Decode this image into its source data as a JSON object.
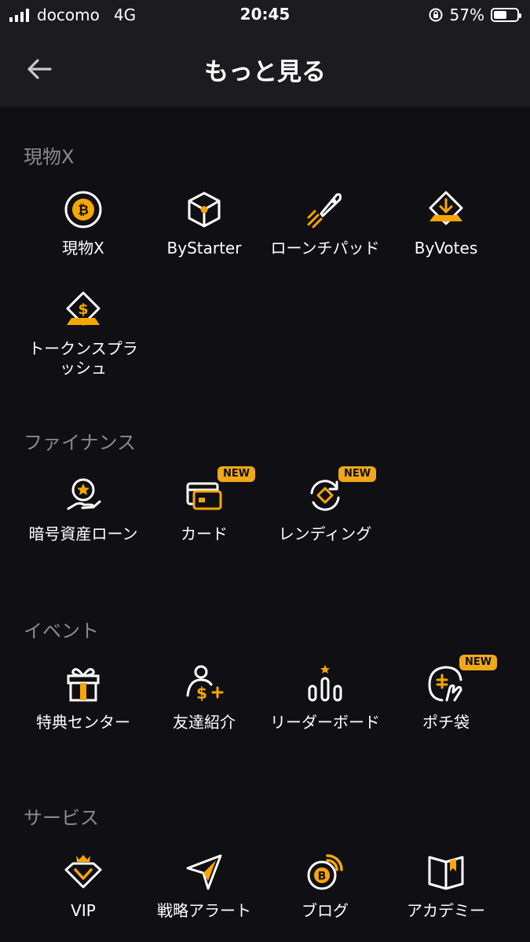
{
  "status_bar": {
    "carrier": "docomo",
    "network": "4G",
    "time": "20:45",
    "battery": "57%",
    "battery_level": 0.57
  },
  "header": {
    "title": "もっと見る"
  },
  "sections": [
    {
      "title": "現物X",
      "items": [
        {
          "label": "現物X",
          "icon": "bitcoin-icon"
        },
        {
          "label": "ByStarter",
          "icon": "cube-icon"
        },
        {
          "label": "ローンチパッド",
          "icon": "rocket-icon"
        },
        {
          "label": "ByVotes",
          "icon": "vote-box-icon"
        },
        {
          "label": "トークンスプラッシュ",
          "icon": "dollar-diamond-icon"
        }
      ]
    },
    {
      "title": "ファイナンス",
      "items": [
        {
          "label": "暗号資産ローン",
          "icon": "loan-hand-icon"
        },
        {
          "label": "カード",
          "icon": "card-icon",
          "badge": "NEW"
        },
        {
          "label": "レンディング",
          "icon": "lending-cycle-icon",
          "badge": "NEW"
        }
      ]
    },
    {
      "title": "イベント",
      "items": [
        {
          "label": "特典センター",
          "icon": "gift-icon"
        },
        {
          "label": "友達紹介",
          "icon": "referral-icon"
        },
        {
          "label": "リーダーボード",
          "icon": "leaderboard-icon"
        },
        {
          "label": "ポチ袋",
          "icon": "red-envelope-icon",
          "badge": "NEW"
        }
      ]
    },
    {
      "title": "サービス",
      "items": [
        {
          "label": "VIP",
          "icon": "vip-crown-icon"
        },
        {
          "label": "戦略アラート",
          "icon": "send-arrow-icon"
        },
        {
          "label": "ブログ",
          "icon": "blog-icon"
        },
        {
          "label": "アカデミー",
          "icon": "book-icon"
        }
      ]
    }
  ],
  "colors": {
    "accent": "#f7a600",
    "background": "#101014",
    "header_background": "#1b1b20",
    "section_title": "#8a8a90"
  }
}
